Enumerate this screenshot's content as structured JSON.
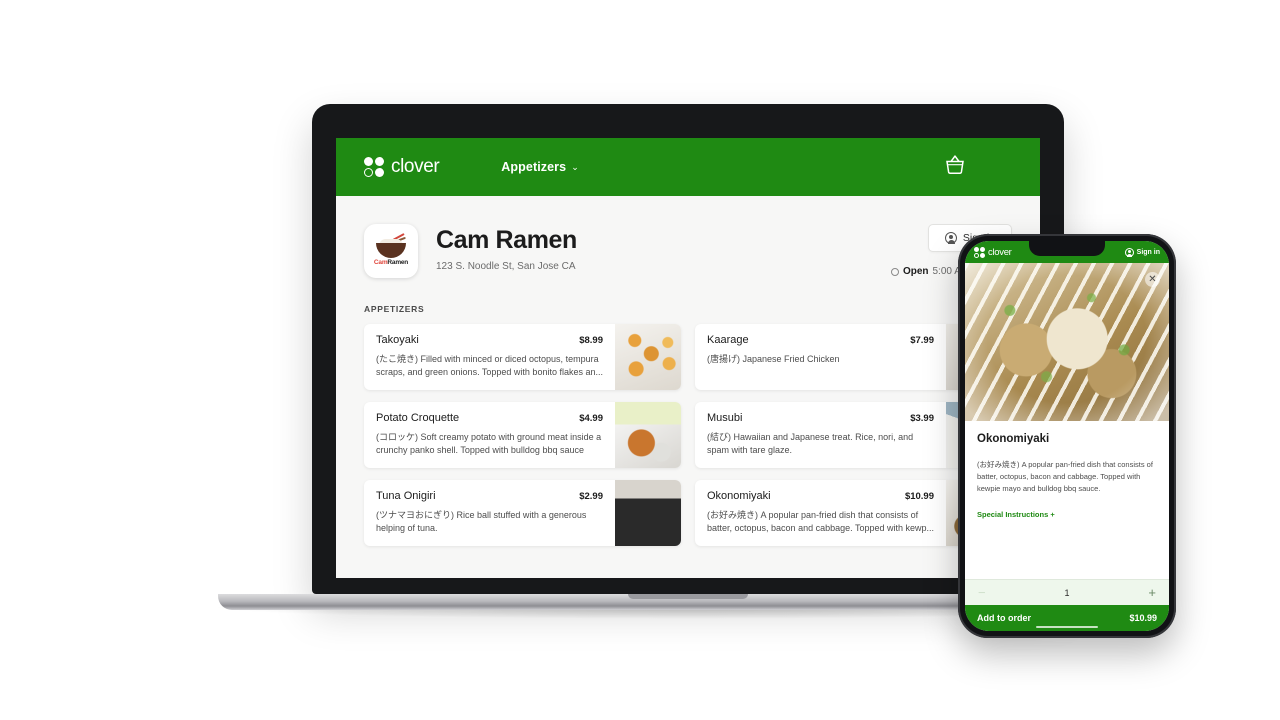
{
  "desktop": {
    "nav": {
      "brand": "clover",
      "brand_icon": "clover-logo-icon",
      "menu_label": "Appetizers",
      "chevron": "⌄",
      "cart_icon": "basket-icon"
    },
    "store": {
      "logo_text_primary": "Cam",
      "logo_text_secondary": "Ramen",
      "logo_icon": "ramen-bowl-icon",
      "name": "Cam Ramen",
      "address": "123 S. Noodle St, San Jose CA",
      "signin_label": "Sign in",
      "signin_icon": "person-circle-icon",
      "status_label": "Open",
      "hours": "5:00 AM - 12:00 A",
      "clock_icon": "clock-icon"
    },
    "menu": {
      "section_label": "APPETIZERS",
      "items": [
        {
          "name": "Takoyaki",
          "price": "$8.99",
          "description": "(たこ焼き) Filled with minced or diced octopus, tempura scraps, and green onions. Topped with bonito flakes an...",
          "image": "takoyaki-photo"
        },
        {
          "name": "Kaarage",
          "price": "$7.99",
          "description": "(唐揚げ) Japanese Fried Chicken",
          "image": "kaarage-photo"
        },
        {
          "name": "Potato Croquette",
          "price": "$4.99",
          "description": "(コロッケ) Soft creamy potato with ground meat inside a crunchy panko shell. Topped with bulldog bbq sauce",
          "image": "croquette-photo"
        },
        {
          "name": "Musubi",
          "price": "$3.99",
          "description": "(結び) Hawaiian and Japanese treat. Rice, nori, and spam with tare glaze.",
          "image": "musubi-photo"
        },
        {
          "name": "Tuna Onigiri",
          "price": "$2.99",
          "description": "(ツナマヨおにぎり) Rice ball stuffed with a generous helping of tuna.",
          "image": "onigiri-photo"
        },
        {
          "name": "Okonomiyaki",
          "price": "$10.99",
          "description": "(お好み焼き) A popular pan-fried dish that consists of batter, octopus, bacon and cabbage. Topped with kewp...",
          "image": "okonomiyaki-photo"
        }
      ]
    }
  },
  "phone": {
    "nav": {
      "brand": "clover",
      "brand_icon": "clover-logo-icon",
      "signin_label": "Sign in",
      "signin_icon": "person-circle-icon"
    },
    "hero": {
      "image": "okonomiyaki-photo",
      "close_icon": "✕"
    },
    "item": {
      "title": "Okonomiyaki",
      "description": "(お好み焼き) A popular pan-fried dish that consists of batter, octopus, bacon and cabbage. Topped with kewpie mayo and bulldog bbq sauce.",
      "special_instructions_label": "Special Instructions +"
    },
    "quantity": {
      "value": "1",
      "increment": "+",
      "decrement": "−"
    },
    "cta": {
      "label": "Add to order",
      "price": "$10.99"
    }
  },
  "colors": {
    "brand_green": "#1f8a13",
    "page_bg": "#f7f7f6",
    "card_bg": "#ffffff",
    "text_primary": "#1c1c1c",
    "text_muted": "#6b6b6b"
  }
}
